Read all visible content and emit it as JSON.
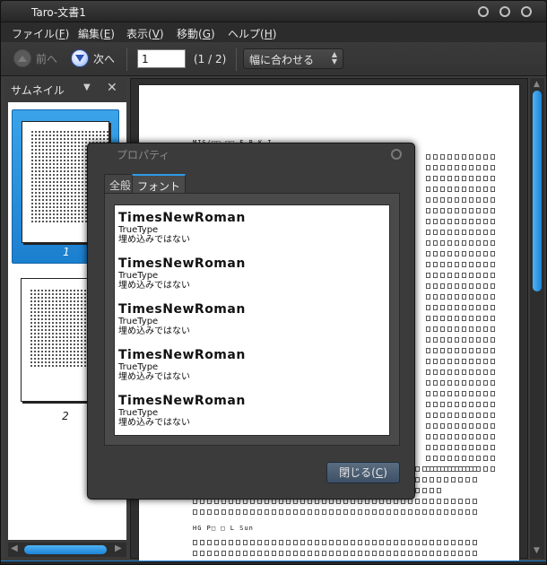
{
  "window": {
    "title": "Taro-文書1"
  },
  "menu": {
    "file": "ファイル(",
    "file_key": "F",
    "edit": "編集(",
    "edit_key": "E",
    "view": "表示(",
    "view_key": "V",
    "go": "移動(",
    "go_key": "G",
    "help": "ヘルプ(",
    "help_key": "H",
    "paren_close": ")"
  },
  "toolbar": {
    "prev_label": "前へ",
    "next_label": "次へ",
    "page_value": "1",
    "page_count": "(1 / 2)",
    "zoom_value": "幅に合わせる"
  },
  "sidebar": {
    "title": "サムネイル",
    "thumbnails": [
      {
        "label": "1",
        "selected": true
      },
      {
        "label": "2",
        "selected": false
      }
    ]
  },
  "document": {
    "heading": "MIS/□□ □□ F.B.K.I.",
    "footer": "HG P□ □ L Sun"
  },
  "dialog": {
    "title": "プロパティ",
    "tabs": [
      "全般",
      "フォント"
    ],
    "active_tab": "フォント",
    "fonts": [
      {
        "name": "TimesNewRoman",
        "type": "TrueType",
        "embed": "埋め込みではない"
      },
      {
        "name": "TimesNewRoman",
        "type": "TrueType",
        "embed": "埋め込みではない"
      },
      {
        "name": "TimesNewRoman",
        "type": "TrueType",
        "embed": "埋め込みではない"
      },
      {
        "name": "TimesNewRoman",
        "type": "TrueType",
        "embed": "埋め込みではない"
      },
      {
        "name": "TimesNewRoman",
        "type": "TrueType",
        "embed": "埋め込みではない"
      }
    ],
    "close_label": "閉じる(",
    "close_key": "C",
    "close_paren": ")"
  },
  "colors": {
    "accent": "#1d84d6",
    "selection": "#3ba3e9",
    "dialog_bg": "#3b3b3b"
  }
}
